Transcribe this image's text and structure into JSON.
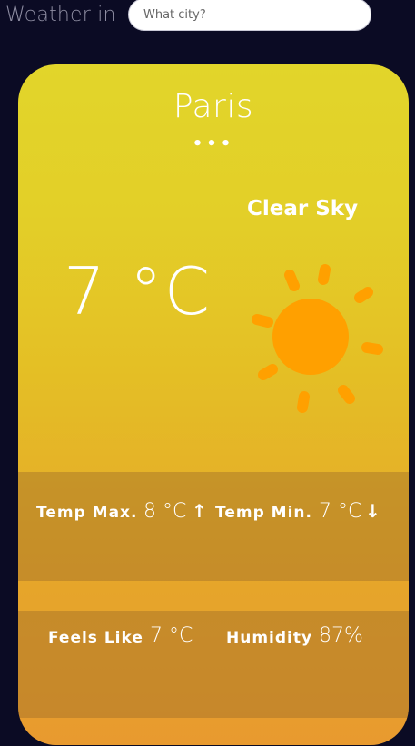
{
  "header": {
    "title": "Weather in",
    "search_placeholder": "What city?"
  },
  "card": {
    "city": "Paris",
    "dots": "•••",
    "condition": "Clear Sky",
    "temperature": "7 °C",
    "weather_icon": "sun-icon",
    "stats": {
      "temp_max_label": "Temp Max.",
      "temp_max_value": "8 °C",
      "temp_max_arrow": "↑",
      "temp_min_label": "Temp Min.",
      "temp_min_value": "7 °C",
      "temp_min_arrow": "↓",
      "feels_like_label": "Feels Like",
      "feels_like_value": "7 °C",
      "humidity_label": "Humidity",
      "humidity_value": "87%"
    }
  },
  "colors": {
    "background": "#0b0b24",
    "card_top": "#e2d52a",
    "card_bottom": "#e89a2f",
    "sun": "#ffa000"
  }
}
